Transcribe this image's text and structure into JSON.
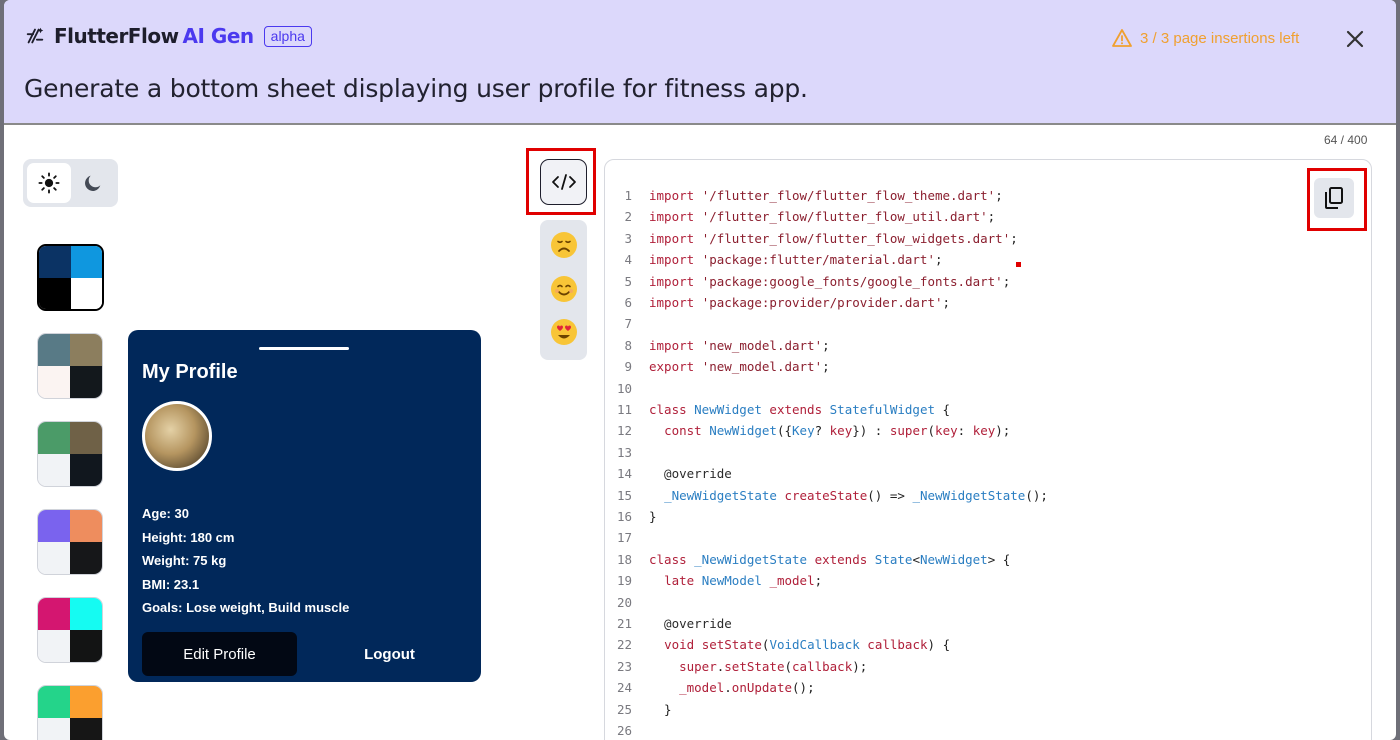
{
  "header": {
    "brand": "FlutterFlow",
    "brand_ai": "AI Gen",
    "badge": "alpha",
    "warning": "3 / 3 page insertions left",
    "prompt": "Generate a bottom sheet displaying user profile for fitness app."
  },
  "counter": "64 / 400",
  "palettes": [
    [
      "#0b3364",
      "#0f97df",
      "#000000",
      "#ffffff"
    ],
    [
      "#587a86",
      "#8c7e5e",
      "#fbf4f2",
      "#13181c"
    ],
    [
      "#4b9b68",
      "#6f6147",
      "#f1f3f6",
      "#11171e"
    ],
    [
      "#7a63ee",
      "#ee8d5e",
      "#f1f3f6",
      "#161719"
    ],
    [
      "#d41670",
      "#15fbf2",
      "#f1f3f6",
      "#131414"
    ],
    [
      "#24d48a",
      "#fb9f2f",
      "#f1f3f6",
      "#161616"
    ]
  ],
  "profile": {
    "title": "My Profile",
    "stats": [
      "Age: 30",
      "Height: 180 cm",
      "Weight: 75 kg",
      "BMI: 23.1",
      "Goals: Lose weight, Build muscle"
    ],
    "edit_label": "Edit Profile",
    "logout_label": "Logout"
  },
  "code_lines": [
    {
      "n": "1",
      "t": [
        [
          "kw",
          "import "
        ],
        [
          "st",
          "'/flutter_flow/flutter_flow_theme.dart'"
        ],
        [
          "pl",
          ";"
        ]
      ]
    },
    {
      "n": "2",
      "t": [
        [
          "kw",
          "import "
        ],
        [
          "st",
          "'/flutter_flow/flutter_flow_util.dart'"
        ],
        [
          "pl",
          ";"
        ]
      ]
    },
    {
      "n": "3",
      "t": [
        [
          "kw",
          "import "
        ],
        [
          "st",
          "'/flutter_flow/flutter_flow_widgets.dart'"
        ],
        [
          "pl",
          ";"
        ]
      ]
    },
    {
      "n": "4",
      "t": [
        [
          "kw",
          "import "
        ],
        [
          "st",
          "'package:flutter/material.dart'"
        ],
        [
          "pl",
          ";"
        ]
      ]
    },
    {
      "n": "5",
      "t": [
        [
          "kw",
          "import "
        ],
        [
          "st",
          "'package:google_fonts/google_fonts.dart'"
        ],
        [
          "pl",
          ";"
        ]
      ]
    },
    {
      "n": "6",
      "t": [
        [
          "kw",
          "import "
        ],
        [
          "st",
          "'package:provider/provider.dart'"
        ],
        [
          "pl",
          ";"
        ]
      ]
    },
    {
      "n": "7",
      "t": []
    },
    {
      "n": "8",
      "t": [
        [
          "kw",
          "import "
        ],
        [
          "st",
          "'new_model.dart'"
        ],
        [
          "pl",
          ";"
        ]
      ]
    },
    {
      "n": "9",
      "t": [
        [
          "kw",
          "export "
        ],
        [
          "st",
          "'new_model.dart'"
        ],
        [
          "pl",
          ";"
        ]
      ]
    },
    {
      "n": "10",
      "t": []
    },
    {
      "n": "11",
      "t": [
        [
          "kw",
          "class "
        ],
        [
          "ty",
          "NewWidget "
        ],
        [
          "kw",
          "extends "
        ],
        [
          "ty",
          "StatefulWidget "
        ],
        [
          "pl",
          "{"
        ]
      ]
    },
    {
      "n": "12",
      "t": [
        [
          "pl",
          "  "
        ],
        [
          "kw",
          "const "
        ],
        [
          "ty",
          "NewWidget"
        ],
        [
          "pl",
          "({"
        ],
        [
          "ty",
          "Key"
        ],
        [
          "pl",
          "? "
        ],
        [
          "kw",
          "key"
        ],
        [
          "pl",
          "}) : "
        ],
        [
          "kw",
          "super"
        ],
        [
          "pl",
          "("
        ],
        [
          "kw",
          "key"
        ],
        [
          "pl",
          ": "
        ],
        [
          "kw",
          "key"
        ],
        [
          "pl",
          ");"
        ]
      ]
    },
    {
      "n": "13",
      "t": []
    },
    {
      "n": "14",
      "t": [
        [
          "an",
          "  @override"
        ]
      ]
    },
    {
      "n": "15",
      "t": [
        [
          "pl",
          "  "
        ],
        [
          "ty",
          "_NewWidgetState "
        ],
        [
          "kw",
          "createState"
        ],
        [
          "pl",
          "() => "
        ],
        [
          "ty",
          "_NewWidgetState"
        ],
        [
          "pl",
          "();"
        ]
      ]
    },
    {
      "n": "16",
      "t": [
        [
          "pl",
          "}"
        ]
      ]
    },
    {
      "n": "17",
      "t": []
    },
    {
      "n": "18",
      "t": [
        [
          "kw",
          "class "
        ],
        [
          "ty",
          "_NewWidgetState "
        ],
        [
          "kw",
          "extends "
        ],
        [
          "ty",
          "State"
        ],
        [
          "pl",
          "<"
        ],
        [
          "ty",
          "NewWidget"
        ],
        [
          "pl",
          "> {"
        ]
      ]
    },
    {
      "n": "19",
      "t": [
        [
          "pl",
          "  "
        ],
        [
          "kw",
          "late "
        ],
        [
          "ty",
          "NewModel "
        ],
        [
          "kw",
          "_model"
        ],
        [
          "pl",
          ";"
        ]
      ]
    },
    {
      "n": "20",
      "t": []
    },
    {
      "n": "21",
      "t": [
        [
          "an",
          "  @override"
        ]
      ]
    },
    {
      "n": "22",
      "t": [
        [
          "pl",
          "  "
        ],
        [
          "kw",
          "void "
        ],
        [
          "kw",
          "setState"
        ],
        [
          "pl",
          "("
        ],
        [
          "ty",
          "VoidCallback "
        ],
        [
          "kw",
          "callback"
        ],
        [
          "pl",
          ") {"
        ]
      ]
    },
    {
      "n": "23",
      "t": [
        [
          "pl",
          "    "
        ],
        [
          "kw",
          "super"
        ],
        [
          "pl",
          "."
        ],
        [
          "kw",
          "setState"
        ],
        [
          "pl",
          "("
        ],
        [
          "kw",
          "callback"
        ],
        [
          "pl",
          ");"
        ]
      ]
    },
    {
      "n": "24",
      "t": [
        [
          "pl",
          "    "
        ],
        [
          "kw",
          "_model"
        ],
        [
          "pl",
          "."
        ],
        [
          "kw",
          "onUpdate"
        ],
        [
          "pl",
          "();"
        ]
      ]
    },
    {
      "n": "25",
      "t": [
        [
          "pl",
          "  }"
        ]
      ]
    },
    {
      "n": "26",
      "t": []
    }
  ]
}
